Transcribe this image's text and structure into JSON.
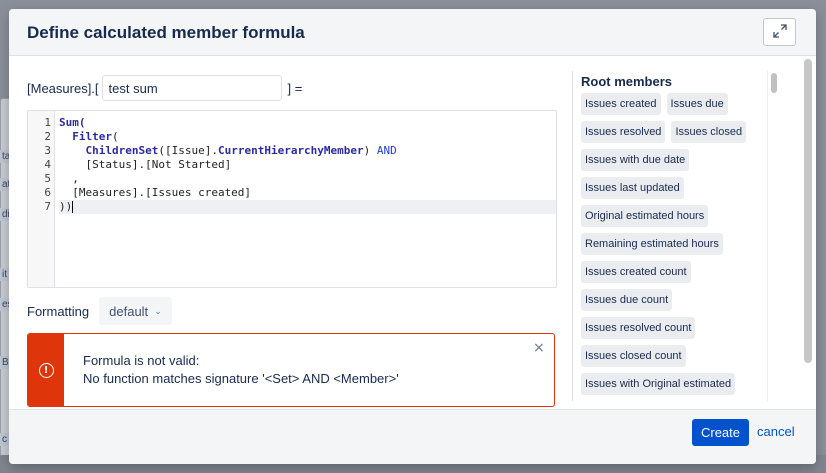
{
  "background": {
    "fragments": [
      "ta",
      "ati",
      "di",
      "it",
      "es",
      "BI",
      "c"
    ]
  },
  "dialog": {
    "title": "Define calculated member formula",
    "expand_icon": "expand-arrows-icon"
  },
  "name_row": {
    "prefix": "[Measures].[",
    "value": "test sum",
    "suffix": "] ="
  },
  "editor": {
    "lines": [
      {
        "num": "1",
        "tokens": [
          {
            "t": "Sum(",
            "c": "fn"
          }
        ]
      },
      {
        "num": "2",
        "tokens": [
          {
            "t": "  "
          },
          {
            "t": "Filter",
            "c": "fn"
          },
          {
            "t": "("
          }
        ]
      },
      {
        "num": "3",
        "tokens": [
          {
            "t": "    "
          },
          {
            "t": "ChildrenSet",
            "c": "fn"
          },
          {
            "t": "([Issue]."
          },
          {
            "t": "CurrentHierarchyMember",
            "c": "fn"
          },
          {
            "t": ") "
          },
          {
            "t": "AND",
            "c": "op"
          }
        ]
      },
      {
        "num": "4",
        "tokens": [
          {
            "t": "    [Status].[Not Started]"
          }
        ]
      },
      {
        "num": "5",
        "tokens": [
          {
            "t": "  ,"
          }
        ]
      },
      {
        "num": "6",
        "tokens": [
          {
            "t": "  [Measures].[Issues created]"
          }
        ]
      },
      {
        "num": "7",
        "tokens": [
          {
            "t": "))"
          }
        ],
        "cursor": true,
        "active": true
      }
    ]
  },
  "formatting": {
    "label": "Formatting",
    "value": "default"
  },
  "error": {
    "icon": "error-circle-icon",
    "title": "Formula is not valid:",
    "message": "No function matches signature '<Set> AND <Member>'",
    "close": "×"
  },
  "members": {
    "title": "Root members",
    "rows": [
      [
        "Issues created",
        "Issues due"
      ],
      [
        "Issues resolved",
        "Issues closed"
      ],
      [
        "Issues with due date"
      ],
      [
        "Issues last updated"
      ],
      [
        "Original estimated hours"
      ],
      [
        "Remaining estimated hours"
      ],
      [
        "Issues created count"
      ],
      [
        "Issues due count"
      ],
      [
        "Issues resolved count"
      ],
      [
        "Issues closed count"
      ],
      [
        "Issues with Original estimated"
      ]
    ]
  },
  "footer": {
    "create": "Create",
    "cancel": "cancel"
  }
}
